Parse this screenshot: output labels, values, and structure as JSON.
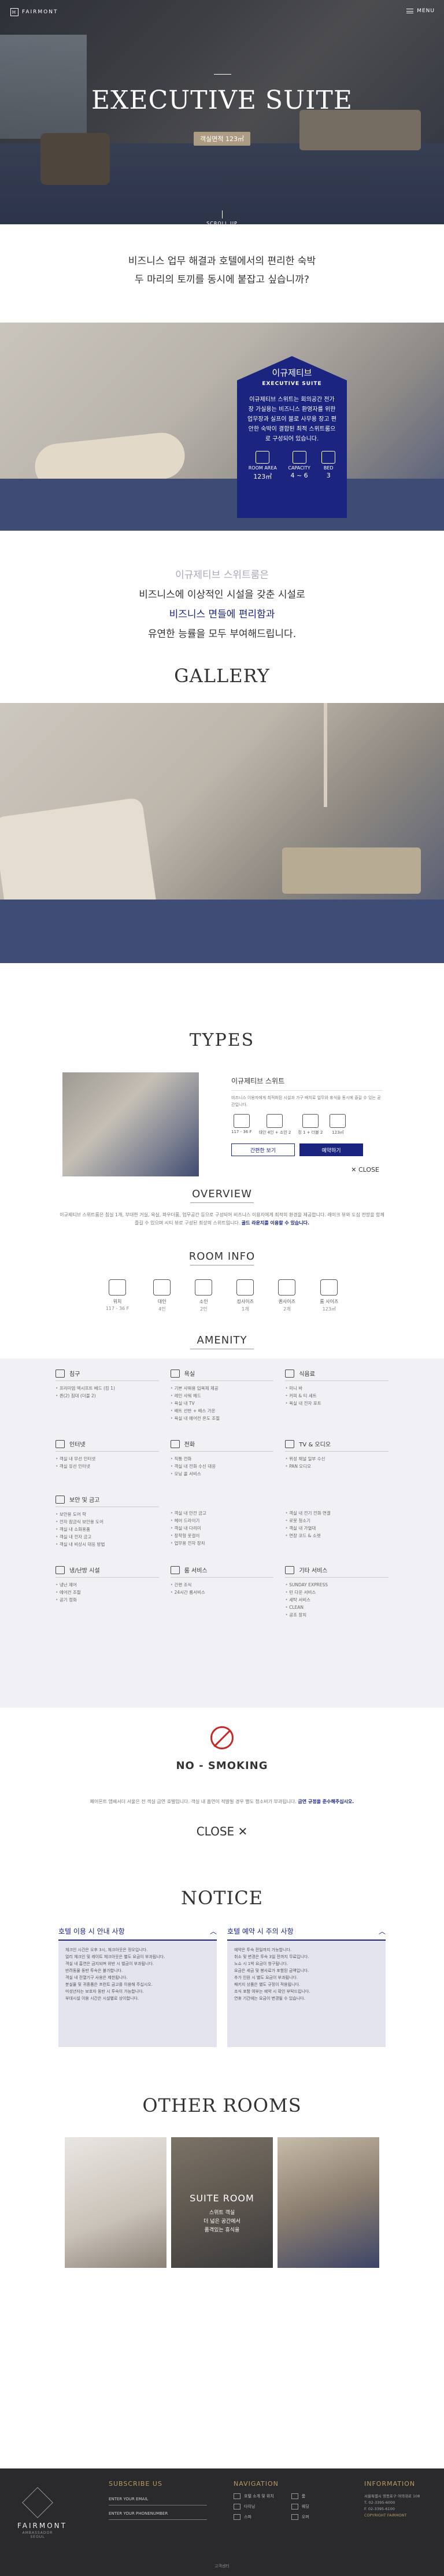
{
  "header": {
    "logo_text": "FAIRMONT",
    "menu_label": "MENU"
  },
  "hero": {
    "title": "EXECUTIVE SUITE",
    "area_badge": "객실면적 123㎡",
    "scroll_label": "SCROLL UP"
  },
  "intro": {
    "line1": "비즈니스 업무 해결과 호텔에서의 편리한 숙박",
    "line2": "두 마리의 토끼를 동시에 붙잡고 싶습니까?"
  },
  "feature_card": {
    "title_ko": "이규제티브",
    "title_en": "EXECUTIVE SUITE",
    "description": "이규제티브 스위트는 회의공간 전가장 가실용는 비즈니스 환영자를 위한 업무장과 실프이 블로 사무용 장고 편안한 숙박이 결합된 최적 스위트룸으로 구성되어 있습니다.",
    "stats": [
      {
        "label": "ROOM AREA",
        "value": "123㎡"
      },
      {
        "label": "CAPACITY",
        "value": "4 ~ 6"
      },
      {
        "label": "BED",
        "value": "3"
      }
    ]
  },
  "textblock": {
    "l1": "이규제티브 스위트룸은",
    "l2": "비즈니스에 이상적인 시설을 갖춘 시설로",
    "l3": "비즈니스 면들에 편리함과",
    "l4": "유연한 능률을 모두 부여해드립니다."
  },
  "gallery": {
    "title": "GALLERY"
  },
  "types": {
    "title": "TYPES",
    "room_name": "이규제티브 스위트",
    "room_desc": "비즈니스 이용자에게 최적화된 시설과 가구 배치로 업무와 휴식을 동시에 즐길 수 있는 공간입니다.",
    "icons": [
      {
        "label": "117 - 36 F"
      },
      {
        "label": "대인 4인 + 소인 2"
      },
      {
        "label": "킹 1 + 더블 2"
      },
      {
        "label": "123㎡"
      }
    ],
    "btn_outline": "간편한 보기",
    "btn_fill": "예약하기",
    "close_small": "CLOSE"
  },
  "overview": {
    "title": "OVERVIEW",
    "text": "이규제티브 스위트룸은 침실 1개, 부대한 거실, 욕실, 파우더룸, 업무공간 등으로 구성되어 비즈니스 이용자에게 최적의 환경을 제공합니다. 레이크 뷰와 도심 전망을 함께 즐길 수 있으며 시티 뷰로 구성된 최상의 스위트입니다.",
    "highlight": "골드 라운지를 이용할 수 있습니다."
  },
  "room_info": {
    "title": "ROOM INFO",
    "items": [
      {
        "label": "위치",
        "value": "117 - 36 F"
      },
      {
        "label": "대인",
        "value": "4인"
      },
      {
        "label": "소인",
        "value": "2인"
      },
      {
        "label": "킹사이즈",
        "value": "1개"
      },
      {
        "label": "퀸사이즈",
        "value": "2개"
      },
      {
        "label": "룸 사이즈",
        "value": "123㎡"
      }
    ]
  },
  "amenity": {
    "title": "AMENITY",
    "groups": [
      {
        "title": "침구",
        "items": [
          "프리미엄 맥시프트 베드 (킹 1)",
          "퀸(2) 침대 (더블 2)"
        ]
      },
      {
        "title": "욕실",
        "items": [
          "기본 샤워용 입욕제 제공",
          "레인 샤워 헤드",
          "욕실 내 TV",
          "배트 선반 + 배스 가운",
          "욕실 내 에어컨 온도 조절"
        ]
      },
      {
        "title": "식음료",
        "items": [
          "미니 바",
          "커피 & 티 세트",
          "욕실 내 전자 포트"
        ]
      },
      {
        "title": "인터넷",
        "items": [
          "객실 내 무선 인터넷",
          "객실 유선 인터넷"
        ]
      },
      {
        "title": "전화",
        "items": [
          "직통 전화",
          "객실 내 전화 수신 대응",
          "모닝 콜 서비스"
        ]
      },
      {
        "title": "TV & 오디오",
        "items": [
          "위성 채널 일부 수신",
          "PAN 오디오"
        ]
      },
      {
        "title": "보안 및 금고",
        "items": [
          "보안용 도어 락",
          "전자 잠금식 보안용 도어",
          "객실 내 소화용품",
          "객실 내 전자 금고",
          "객실 내 비상시 대응 방법"
        ]
      },
      {
        "title": "",
        "items": [
          "객실 내 안전 금고",
          "헤어 드라이기",
          "객실 내 다리미",
          "장착형 옷걸이",
          "업무용 전자 장치"
        ]
      },
      {
        "title": "",
        "items": [
          "객실 내 전기 전화 연결",
          "로봇 청소기",
          "객실 내 가열대",
          "연장 코드 & 소켓"
        ]
      },
      {
        "title": "냉/난방 시설",
        "items": [
          "냉난 제어",
          "에어컨 조절",
          "공기 정화"
        ]
      },
      {
        "title": "룸 서비스",
        "items": [
          "간편 조식",
          "24시간 룸서비스"
        ]
      },
      {
        "title": "기타 서비스",
        "items": [
          "SUNDAY EXPRESS",
          "턴 다운 서비스",
          "세탁 서비스",
          "CLEAN",
          "공조 장치"
        ]
      }
    ]
  },
  "no_smoking": {
    "title": "NO - SMOKING",
    "text": "페어몬트 앰배서더 서울은 전 객실 금연 호텔입니다. 객실 내 흡연이 적발될 경우 별도 청소비가 부과됩니다.",
    "highlight": "금연 규정을 준수해주십시오."
  },
  "close_large": "CLOSE",
  "notice": {
    "title": "NOTICE",
    "left_title": "호텔 이용 시 안내 사항",
    "right_title": "호텔 예약 시 주의 사항",
    "left_items": [
      "체크인 시간은 오후 3시, 체크아웃은 정오입니다.",
      "얼리 체크인 및 레이트 체크아웃은 별도 요금이 부과됩니다.",
      "객실 내 흡연은 금지되며 위반 시 벌금이 부과됩니다.",
      "반려동물 동반 투숙은 불가합니다.",
      "객실 내 전열기구 사용은 제한됩니다.",
      "분실물 및 귀중품은 프런트 금고를 이용해 주십시오.",
      "미성년자는 보호자 동반 시 투숙이 가능합니다.",
      "부대시설 이용 시간은 시설별로 상이합니다."
    ],
    "right_items": [
      "예약은 투숙 전일까지 가능합니다.",
      "취소 및 변경은 투숙 3일 전까지 무료입니다.",
      "노쇼 시 1박 요금이 청구됩니다.",
      "요금은 세금 및 봉사료가 포함된 금액입니다.",
      "추가 인원 시 별도 요금이 부과됩니다.",
      "패키지 상품은 별도 규정이 적용됩니다.",
      "조식 포함 여부는 예약 시 확인 부탁드립니다.",
      "연휴 기간에는 요금이 변경될 수 있습니다."
    ]
  },
  "other_rooms": {
    "title": "OTHER ROOMS",
    "rooms": [
      {
        "name": "",
        "sub": ""
      },
      {
        "name": "SUITE ROOM",
        "sub": "스위트 객실\n더 넓은 공간에서\n품격있는 휴식을"
      },
      {
        "name": "",
        "sub": ""
      }
    ]
  },
  "footer": {
    "logo_name": "FAIRMONT",
    "logo_sub": "AMBASSADOR SEOUL",
    "subscribe_title": "SUBSCRIBE US",
    "email_label": "ENTER YOUR EMAIL",
    "phone_label": "ENTER YOUR PHONENUMBER",
    "nav_title": "NAVIGATION",
    "nav_items": [
      "호텔 소개 및 위치",
      "룸",
      "다이닝",
      "웨딩",
      "스파",
      "오퍼"
    ],
    "info_title": "INFORMATION",
    "info_lines": [
      "서울특별시 영등포구 여의대로 108",
      "T. 02-3395-6000",
      "F. 02-3395-6100",
      "COPYRIGHT FAIRMONT"
    ],
    "copyright": "고객센터"
  }
}
